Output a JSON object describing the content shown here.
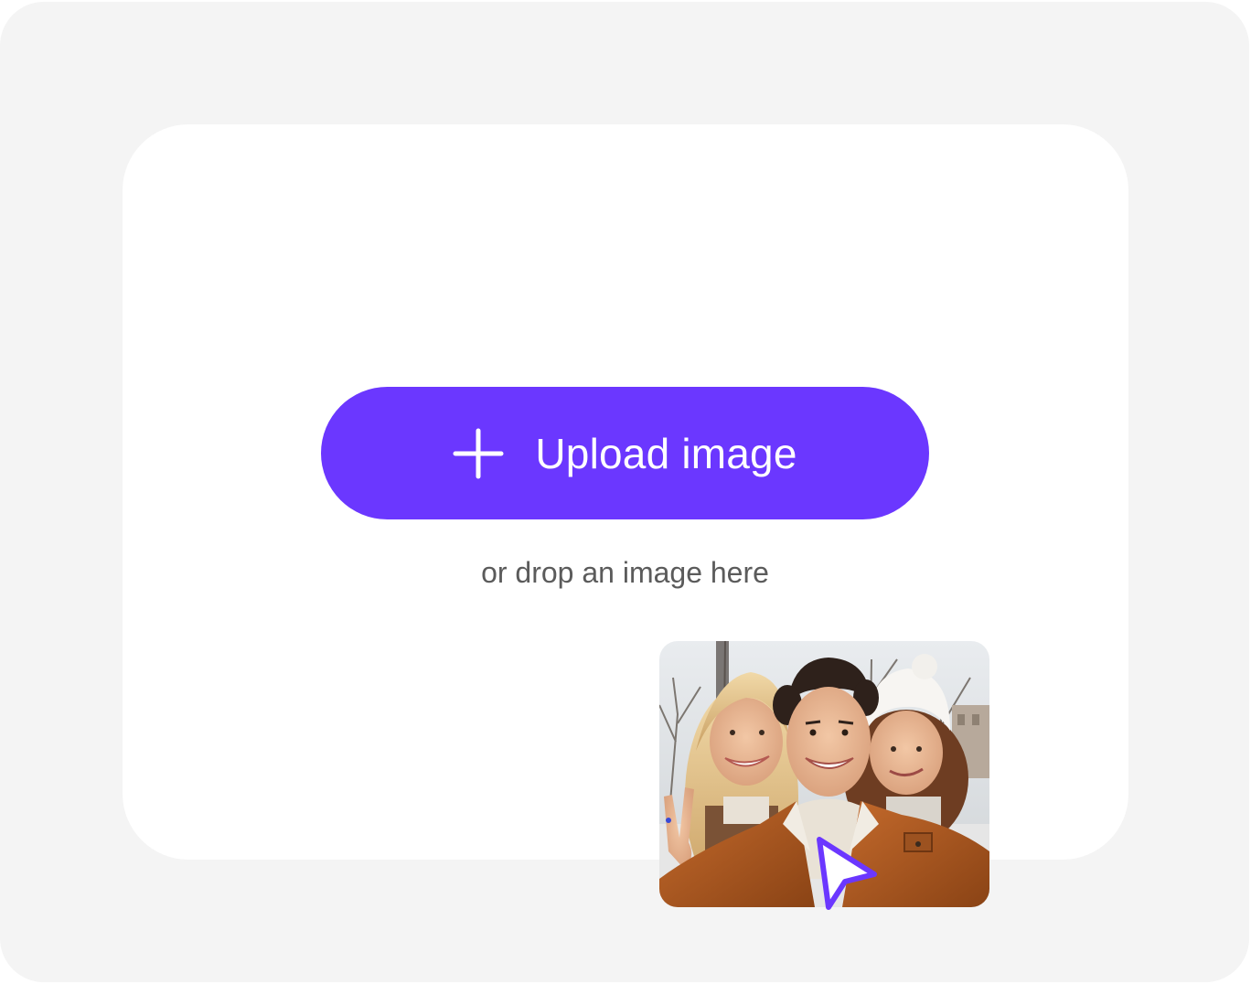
{
  "upload": {
    "button_label": "Upload image",
    "button_icon": "plus-icon",
    "drop_hint": "or drop an image here"
  },
  "dragged_image": {
    "description_icon": "photo-thumbnail",
    "cursor_icon": "pointer-cursor-icon"
  },
  "colors": {
    "accent": "#6b37ff",
    "frame_background": "#f4f4f4",
    "drop_zone_background": "#ffffff",
    "hint_text": "#5b5b5b"
  }
}
